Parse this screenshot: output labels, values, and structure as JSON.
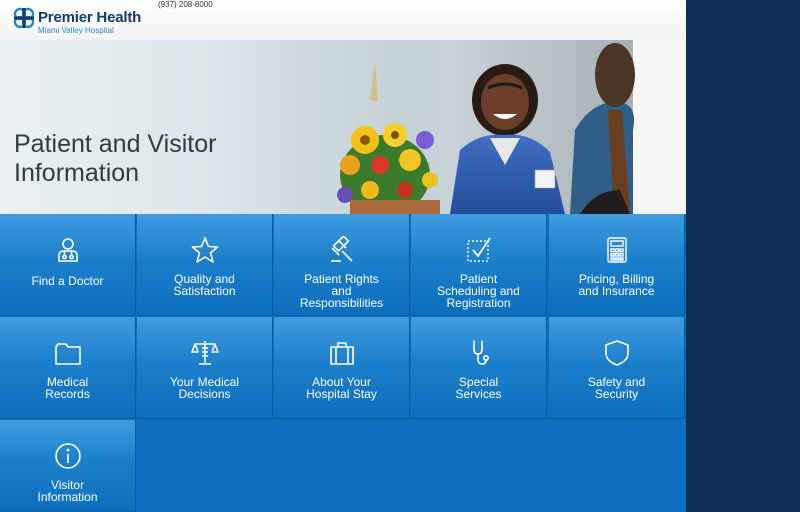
{
  "header": {
    "brand": "Premier Health",
    "subbrand": "Miami Valley Hospital",
    "phone": "(937) 208-8000"
  },
  "hero": {
    "title_line1": "Patient and Visitor",
    "title_line2": "Information"
  },
  "tiles": [
    {
      "icon": "doctor-icon",
      "line1": "Find a Doctor",
      "line2": "",
      "line3": ""
    },
    {
      "icon": "star-icon",
      "line1": "Quality and",
      "line2": "Satisfaction",
      "line3": ""
    },
    {
      "icon": "gavel-icon",
      "line1": "Patient Rights",
      "line2": "and",
      "line3": "Responsibilities"
    },
    {
      "icon": "checkbox-icon",
      "line1": "Patient",
      "line2": "Scheduling and",
      "line3": "Registration"
    },
    {
      "icon": "calculator-icon",
      "line1": "Pricing, Billing",
      "line2": "and Insurance",
      "line3": ""
    },
    {
      "icon": "folder-icon",
      "line1": "Medical",
      "line2": "Records",
      "line3": ""
    },
    {
      "icon": "scales-icon",
      "line1": "Your Medical",
      "line2": "Decisions",
      "line3": ""
    },
    {
      "icon": "suitcase-icon",
      "line1": "About Your",
      "line2": "Hospital Stay",
      "line3": ""
    },
    {
      "icon": "stethoscope-icon",
      "line1": "Special",
      "line2": "Services",
      "line3": ""
    },
    {
      "icon": "shield-icon",
      "line1": "Safety and",
      "line2": "Security",
      "line3": ""
    },
    {
      "icon": "info-icon",
      "line1": "Visitor",
      "line2": "Information",
      "line3": ""
    }
  ],
  "colors": {
    "tile_blue": "#1c7fcb",
    "dark_panel": "#0c2f52",
    "brand_navy": "#153b66"
  }
}
